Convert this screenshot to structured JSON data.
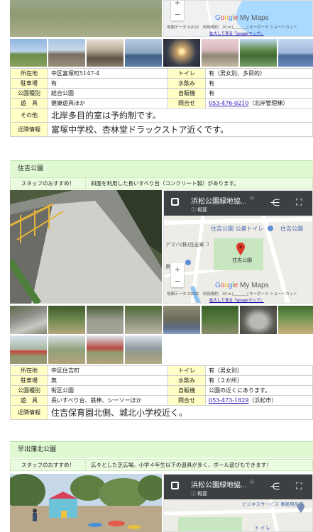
{
  "park1": {
    "map": {
      "google": "Google My Maps",
      "attribution": "地図データ ©2022　利用規約　20 m ⌊______⌋ キーボード ショートカット",
      "link": "拡大して見る「googleマップ」"
    },
    "info": {
      "rows": [
        {
          "l1": "所在地",
          "v1": "中区富塚町5147-4",
          "l2": "トイレ",
          "v2": "有（男女別、多目的）"
        },
        {
          "l1": "駐車場",
          "v1": "有",
          "l2": "水飲み",
          "v2": "有"
        },
        {
          "l1": "公園種別",
          "v1": "総合公園",
          "l2": "自販機",
          "v2": "有"
        },
        {
          "l1": "遊　具",
          "v1": "健康遊具ほか",
          "l2": "問合せ",
          "v2_link": "053-476-0210",
          "v2_extra": "（北岸管理棟）"
        }
      ],
      "other_label": "その他",
      "other_value": "北岸多目的室は予約制です。",
      "near_label": "近隣情報",
      "near_value": "富塚中学校、杏林堂ドラックストア近くです。"
    }
  },
  "park2": {
    "title": "住吉公園",
    "recommend_label": "スタッフのおすすめ！",
    "recommend_value": "斜面を利用した長いすべり台（コンクリート製）があります。",
    "map": {
      "title": "浜松公園緑地協...",
      "subtitle": "概要",
      "label_park": "住吉公園",
      "label_toilet": "住吉公園 公衆トイレ",
      "label_top": "住吉公園",
      "label_shop": "アマハ(株)住吉寮",
      "label_side": "景",
      "label_pin": "住吉公園",
      "label_road": "コ",
      "google": "Google My Maps",
      "attribution": "地図データ ©2022　利用規約　20 m ⌊______⌋ キーボード ショートカット",
      "link": "拡大して見る「googleマップ」"
    },
    "info": {
      "rows": [
        {
          "l1": "所在地",
          "v1": "中区住吉町",
          "l2": "トイレ",
          "v2": "有（男女別）"
        },
        {
          "l1": "駐車場",
          "v1": "無",
          "l2": "水飲み",
          "v2": "有（２か所）"
        },
        {
          "l1": "公園種別",
          "v1": "街区公園",
          "l2": "自販機",
          "v2": "公園の近くにあります。"
        },
        {
          "l1": "遊　具",
          "v1": "長いすべり台、鉄棒、シーソーほか",
          "l2": "問合せ",
          "v2_link": "053-473-1829",
          "v2_extra": "（浜松市）"
        }
      ],
      "near_label": "近隣情報",
      "near_value": "住吉保育園北側、城北小学校近く。"
    }
  },
  "park3": {
    "title": "早出蒲北公園",
    "recommend_label": "スタッフのおすすめ！",
    "recommend_value": "広々とした芝広場。小学４年生以下の遊具が多く、ボール遊びもできます！",
    "map": {
      "title": "浜松公園緑地協...",
      "subtitle": "概要",
      "label_store": "ビジネスサービス 事務用品店",
      "label_toilet": "トイレ"
    }
  },
  "icons": [
    "menu-icon",
    "star-icon",
    "share-icon",
    "fullscreen-icon",
    "pin-icon",
    "pegman-icon"
  ]
}
